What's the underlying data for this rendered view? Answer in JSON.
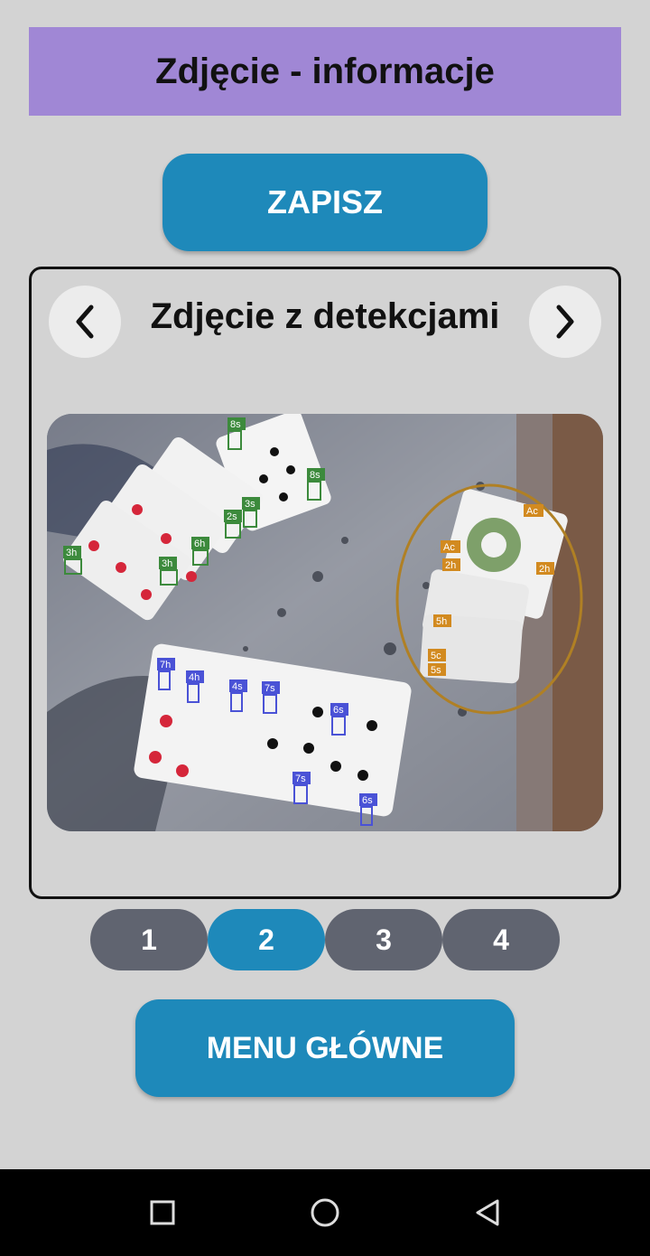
{
  "header": {
    "title": "Zdjęcie - informacje"
  },
  "actions": {
    "save_label": "ZAPISZ",
    "main_menu_label": "MENU GŁÓWNE"
  },
  "viewer": {
    "title": "Zdjęcie z detekcjami",
    "prev_icon": "chevron-left-icon",
    "next_icon": "chevron-right-icon"
  },
  "photo": {
    "description_icon": "playing-cards-photo",
    "green_labels": [
      "8s",
      "8s",
      "3s",
      "2s",
      "6h",
      "3h",
      "3h"
    ],
    "orange_labels": [
      "Ac",
      "Ac",
      "2h",
      "2h",
      "5h",
      "5c",
      "5s"
    ],
    "blue_labels": [
      "7h",
      "4h",
      "4s",
      "7s",
      "6s",
      "7s",
      "6s"
    ]
  },
  "pagination": {
    "pages": [
      "1",
      "2",
      "3",
      "4"
    ],
    "active": "2"
  },
  "system_nav": {
    "icons": [
      "recent-apps-icon",
      "home-icon",
      "back-icon"
    ]
  },
  "colors": {
    "title_bg": "#a087d5",
    "button": "#1e89ba",
    "page_inactive": "#606470",
    "background": "#d3d3d3"
  }
}
